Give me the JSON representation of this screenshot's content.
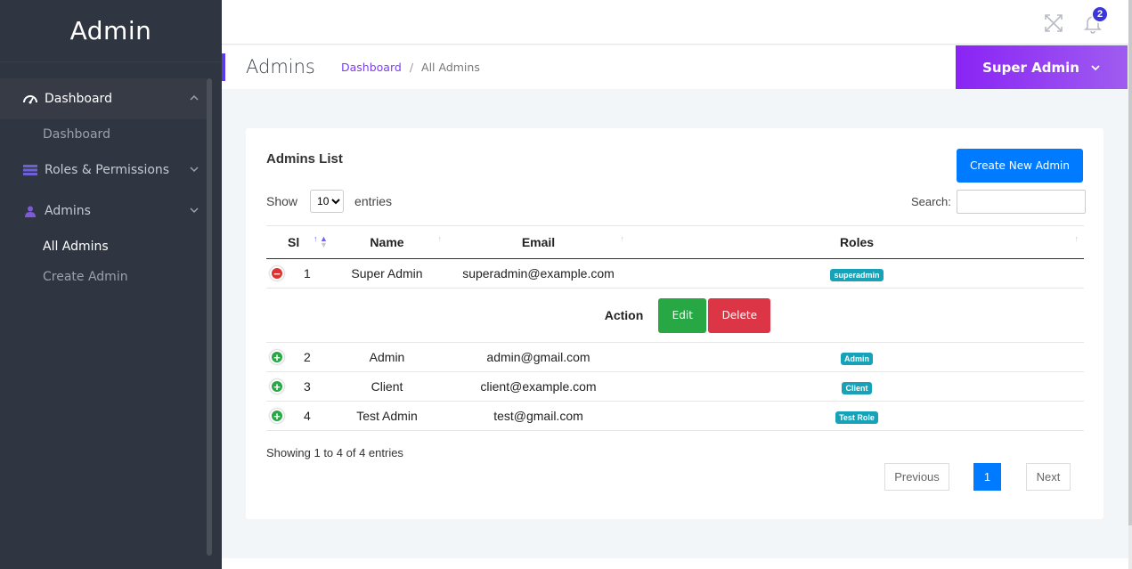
{
  "sidebar": {
    "brand": "Admin",
    "menu": [
      {
        "label": "Dashboard",
        "icon": "dashboard-icon"
      },
      {
        "label": "Roles & Permissions",
        "icon": "list-icon"
      },
      {
        "label": "Admins",
        "icon": "user-icon"
      }
    ],
    "submenu": {
      "dashboard": "Dashboard",
      "all_admins": "All Admins",
      "create_admin": "Create Admin"
    }
  },
  "topbar": {
    "notification_count": "2"
  },
  "header": {
    "title": "Admins",
    "breadcrumb_link": "Dashboard",
    "breadcrumb_sep": "/",
    "breadcrumb_current": "All Admins",
    "user_name": "Super Admin"
  },
  "card": {
    "title": "Admins List",
    "create_button": "Create New Admin",
    "show_label": "Show",
    "entries_label": "entries",
    "page_length": "10",
    "search_label": "Search:",
    "search_value": ""
  },
  "table": {
    "columns": [
      "Sl",
      "Name",
      "Email",
      "Roles"
    ],
    "rows": [
      {
        "sl": "1",
        "name": "Super Admin",
        "email": "superadmin@example.com",
        "role": "superadmin"
      },
      {
        "sl": "2",
        "name": "Admin",
        "email": "admin@gmail.com",
        "role": "Admin"
      },
      {
        "sl": "3",
        "name": "Client",
        "email": "client@example.com",
        "role": "Client"
      },
      {
        "sl": "4",
        "name": "Test Admin",
        "email": "test@gmail.com",
        "role": "Test Role"
      }
    ],
    "child": {
      "action_label": "Action",
      "edit_label": "Edit",
      "delete_label": "Delete"
    }
  },
  "footer": {
    "info": "Showing 1 to 4 of 4 entries",
    "previous": "Previous",
    "current_page": "1",
    "next": "Next"
  },
  "colors": {
    "sidebar_bg": "#303641",
    "accent_purple": "#8a24f5",
    "primary_blue": "#007bff",
    "success_green": "#28a745",
    "danger_red": "#dc3545",
    "badge_teal": "#17a2b8"
  }
}
